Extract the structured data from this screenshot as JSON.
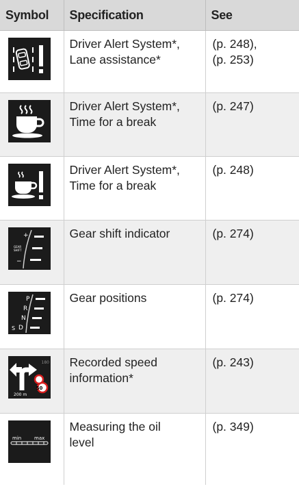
{
  "header": {
    "symbol": "Symbol",
    "specification": "Specification",
    "see": "See"
  },
  "rows": [
    {
      "icon": "lane-departure-warning-icon",
      "spec": [
        "Driver Alert System*,",
        "Lane assistance*"
      ],
      "see": [
        "(p. 248),",
        "(p. 253)"
      ]
    },
    {
      "icon": "coffee-cup-break-icon",
      "spec": [
        "Driver Alert System*,",
        "Time for a break"
      ],
      "see": [
        "(p. 247)"
      ]
    },
    {
      "icon": "coffee-cup-warning-icon",
      "spec": [
        "Driver Alert System*,",
        "Time for a break"
      ],
      "see": [
        "(p. 248)"
      ]
    },
    {
      "icon": "gear-shift-indicator-icon",
      "spec": [
        "Gear shift indicator"
      ],
      "see": [
        "(p. 274)"
      ],
      "icon_text": [
        "+",
        "GEAR",
        "SHIFT",
        "−"
      ]
    },
    {
      "icon": "gear-positions-icon",
      "spec": [
        "Gear positions"
      ],
      "see": [
        "(p. 274)"
      ],
      "icon_text": [
        "P",
        "R",
        "N",
        "D",
        "S"
      ]
    },
    {
      "icon": "speed-information-icon",
      "spec": [
        "Recorded speed",
        "information*"
      ],
      "see": [
        "(p. 243)"
      ],
      "icon_text": [
        "200 m",
        "50",
        "180"
      ]
    },
    {
      "icon": "oil-level-gauge-icon",
      "spec": [
        "Measuring the oil",
        "level"
      ],
      "see": [
        "(p. 349)"
      ],
      "icon_text": [
        "min",
        "max"
      ]
    }
  ]
}
